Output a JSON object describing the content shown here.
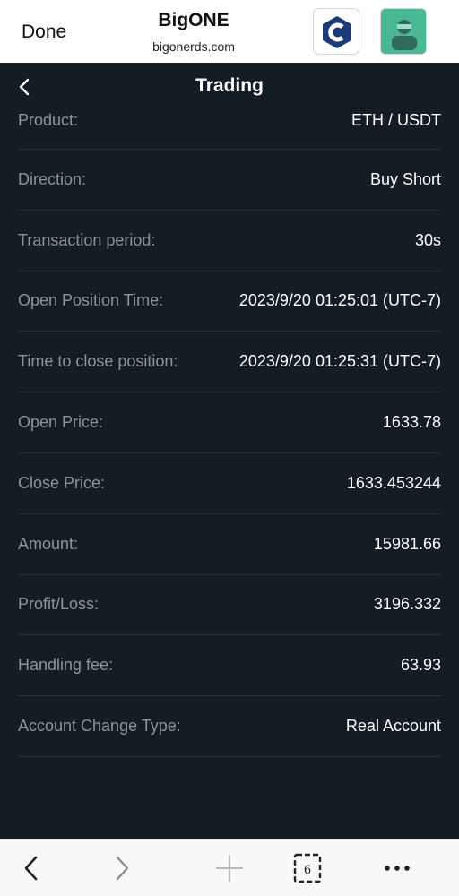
{
  "browser": {
    "done_label": "Done",
    "site_title": "BigONE",
    "site_url": "bigonerds.com",
    "tab_count": "6"
  },
  "page": {
    "title": "Trading"
  },
  "details": [
    {
      "label": "Product:",
      "value": "ETH / USDT"
    },
    {
      "label": "Direction:",
      "value": "Buy Short"
    },
    {
      "label": "Transaction period:",
      "value": "30s"
    },
    {
      "label": "Open Position Time:",
      "value": "2023/9/20 01:25:01 (UTC-7)"
    },
    {
      "label": "Time to close position:",
      "value": "2023/9/20 01:25:31 (UTC-7)"
    },
    {
      "label": "Open Price:",
      "value": "1633.78"
    },
    {
      "label": "Close Price:",
      "value": "1633.453244"
    },
    {
      "label": "Amount:",
      "value": "15981.66"
    },
    {
      "label": "Profit/Loss:",
      "value": "3196.332"
    },
    {
      "label": "Handling fee:",
      "value": "63.93"
    },
    {
      "label": "Account Change Type:",
      "value": "Real Account"
    }
  ],
  "colors": {
    "background": "#141c24",
    "label": "#8e949c",
    "value": "#ffffff",
    "divider": "#2a333d"
  }
}
